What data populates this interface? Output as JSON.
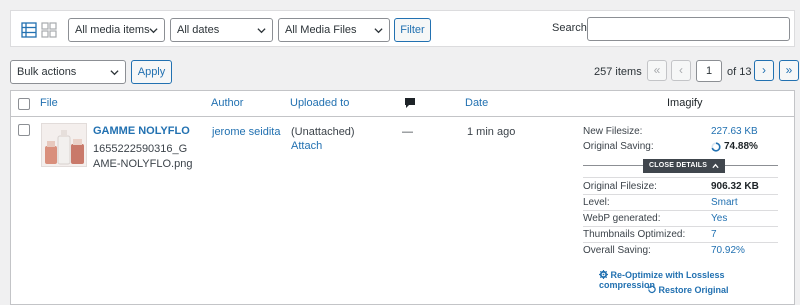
{
  "filters": {
    "media_type": "All media items",
    "dates": "All dates",
    "media_files": "All Media Files",
    "filter_button": "Filter",
    "search_label": "Search",
    "search_value": ""
  },
  "tablenav": {
    "bulk_actions": "Bulk actions",
    "apply_button": "Apply",
    "item_count": "257 items",
    "first_page": "«",
    "prev_page": "‹",
    "current_page": "1",
    "of_pages": "of 13",
    "next_page": "›",
    "last_page": "»"
  },
  "columns": {
    "file": "File",
    "author": "Author",
    "uploaded_to": "Uploaded to",
    "date": "Date",
    "imagify": "Imagify"
  },
  "rows": [
    {
      "title": "GAMME NOLYFLO",
      "filename": "1655222590316_GAME-NOLYFLO.png",
      "author": "jerome seidita",
      "uploaded_to": "(Unattached)",
      "attach_link": "Attach",
      "comments": "—",
      "date": "1 min ago",
      "imagify": {
        "new_filesize_label": "New Filesize:",
        "new_filesize": "227.63 KB",
        "original_saving_label": "Original Saving:",
        "original_saving": "74.88%",
        "close_details": "CLOSE DETAILS",
        "original_filesize_label": "Original Filesize:",
        "original_filesize": "906.32 KB",
        "level_label": "Level:",
        "level": "Smart",
        "webp_label": "WebP generated:",
        "webp": "Yes",
        "thumbnails_label": "Thumbnails Optimized:",
        "thumbnails": "7",
        "overall_saving_label": "Overall Saving:",
        "overall_saving": "70.92%",
        "reoptimize": "Re-Optimize with Lossless compression",
        "restore": "Restore Original"
      }
    }
  ],
  "colors": {
    "link": "#2271b1",
    "border": "#c3c4c7",
    "background": "#f0f0f1"
  }
}
